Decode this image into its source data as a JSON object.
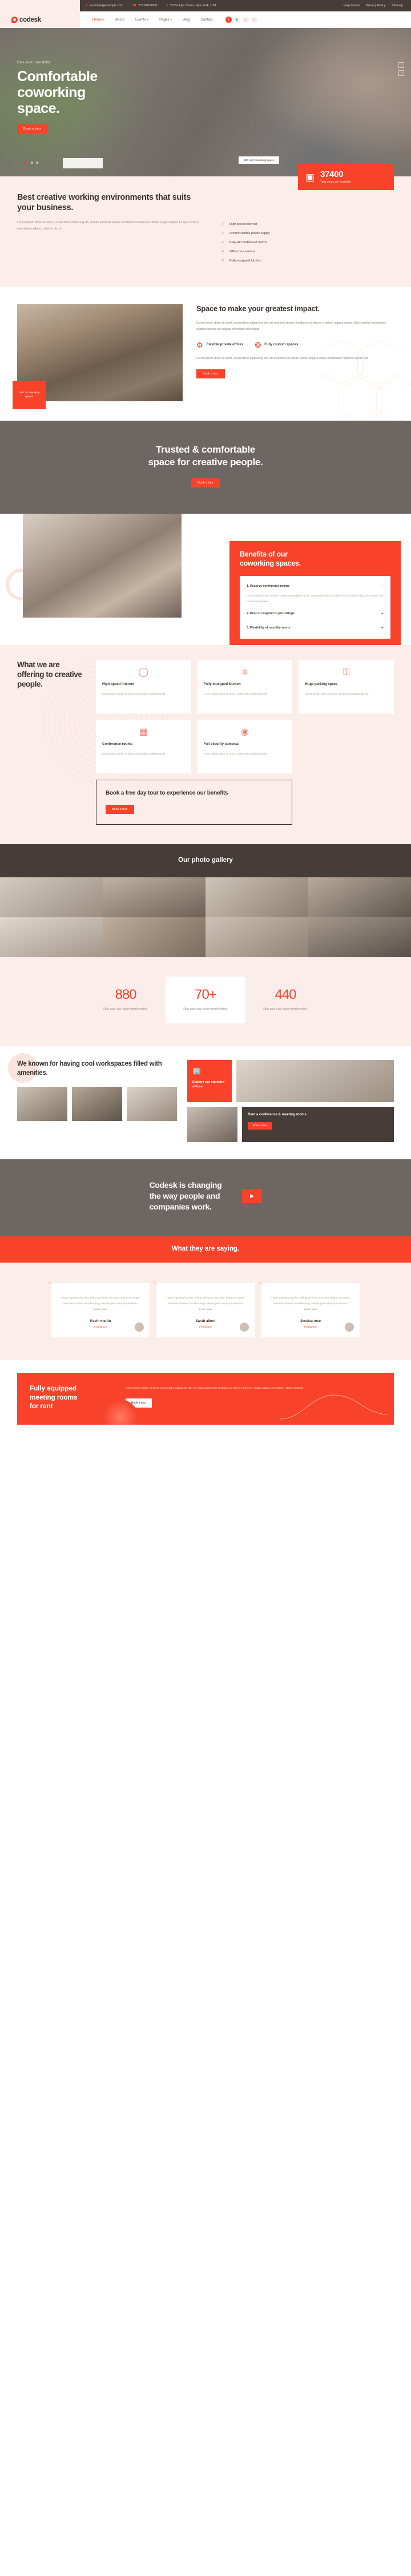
{
  "topbar": {
    "email": "example@example.com",
    "email_icon": "envelope-icon",
    "phone": "777 888 0000",
    "phone_icon": "phone-icon",
    "address": "20 Broklyn Street, New York, USA",
    "address_icon": "location-pin-icon",
    "links": [
      "Help Center",
      "Privacy Policy",
      "Sitemap"
    ]
  },
  "nav": {
    "brand": "codesk",
    "items": [
      {
        "label": "Home",
        "caret": "▾",
        "active": true
      },
      {
        "label": "About",
        "caret": "",
        "active": false
      },
      {
        "label": "Events",
        "caret": "▾",
        "active": false
      },
      {
        "label": "Pages",
        "caret": "▾",
        "active": false
      },
      {
        "label": "Blog",
        "caret": "",
        "active": false
      },
      {
        "label": "Contact",
        "caret": "",
        "active": false
      }
    ],
    "socials": [
      "facebook-icon",
      "twitter-icon",
      "instagram-icon",
      "dribbble-icon"
    ]
  },
  "hero": {
    "eyebrow": "Duis aute irure dolor",
    "title_line1": "Comfortable",
    "title_line2": "coworking",
    "title_line3": "space.",
    "button": "Book a tour",
    "tag": "480 sq ft coworking space",
    "arrow_up": "‹",
    "arrow_down": "›"
  },
  "about": {
    "heading": "Best creative working environments that suits your business.",
    "paragraph": "Lorem ipsum dolor sit amet, consectetur adipiscing elit, sed do eiusmod tempor incididunt ut labore et dolore magna aliqua. Ut quis nostrud exercitation ullamco laboris nisi ut.",
    "counter_number": "37400",
    "counter_label": "Total seats are available",
    "counter_icon": "coworking-seats-icon",
    "checklist": [
      "High speed internet",
      "Uninterruptible power supply",
      "Fully Airconditioned rooms",
      "Office boy service",
      "Fully equipped kitchen"
    ]
  },
  "impact": {
    "badge": "Over 20 coworking spaces",
    "heading": "Space to make your greatest impact.",
    "paragraph": "Lorem ipsum dolor sit amet, consectetur adipiscing elit, set eiusmod tempor incididunt ut labore et dolore magna aliqua. Quis nostrud exercitation ullamco laboris nisi aliquip commodo consequat.",
    "features": [
      {
        "icon": "private-office-icon",
        "title": "Flexible private offices"
      },
      {
        "icon": "custom-space-icon",
        "title": "Fully custom spaces"
      }
    ],
    "paragraph2": "Lorem ipsum dolor sit amet, consectetur adipiscing elit, set incididunt ut labore dolore magna aliqua exercitation ullamco laboris nisi.",
    "button": "Book a tour"
  },
  "trusted": {
    "line1": "Trusted & comfortable",
    "line2": "space for creative people.",
    "button": "Book a tour"
  },
  "benefits": {
    "heading_line1": "Benefits of our",
    "heading_line2": "coworking spaces.",
    "items": [
      {
        "title": "1. Reserve conference rooms",
        "toggle": "−",
        "open": true,
        "body": "Lorem ipsum dolor sit amet, consectetur adipiscing elit, eiusmod tempor incididunt  labore dolore aliqua, excepteur sint occaecat cupidatat."
      },
      {
        "title": "2. Post or respond to job listings",
        "toggle": "+",
        "open": false,
        "body": ""
      },
      {
        "title": "3. Flexibility of monthly terms",
        "toggle": "+",
        "open": false,
        "body": ""
      }
    ]
  },
  "offering": {
    "title": "What we are offering to creative people.",
    "cards": [
      {
        "icon": "wifi-signal-icon",
        "title": "High speed internet",
        "text": "Lorem ipsum dolor sit amet, consectetur adipiscing elit."
      },
      {
        "icon": "kitchen-tray-icon",
        "title": "Fully equipped kitchen",
        "text": "Lorem ipsum dolor sit amet, consectetur adipiscing elit."
      },
      {
        "icon": "parking-car-icon",
        "title": "Huge parking space",
        "text": "Lorem ipsum dolor sit amet, consectetur adipiscing elit."
      },
      {
        "icon": "conference-table-icon",
        "title": "Conference rooms",
        "text": "Lorem ipsum dolor sit amet, consectetur adipiscing elit."
      },
      {
        "icon": "security-camera-icon",
        "title": "Full security cameras",
        "text": "Lorem ipsum dolor sit amet, consectetur adipiscing elit."
      }
    ],
    "cta_title": "Book a free day tour to experience our benefits",
    "cta_button": "Book a tour"
  },
  "gallery": {
    "title": "Our photo gallery"
  },
  "counters": [
    {
      "number": "880",
      "label": "Duis aute irure dolor reprehenderit."
    },
    {
      "number": "70+",
      "label": "Duis aute irure dolor reprehenderit."
    },
    {
      "number": "440",
      "label": "Duis aute irure dolor reprehenderit."
    }
  ],
  "amenities": {
    "heading": "We known for having cool workspaces filled with amenities.",
    "explore_icon": "office-building-icon",
    "explore_title": "Explore our standard offices",
    "rent_title": "Rent a conference & meeting rooms",
    "rent_button": "Book a tour"
  },
  "video": {
    "line1": "Codesk is changing",
    "line2": "the way people and",
    "line3": "companies work.",
    "play_icon": "play-icon"
  },
  "testimonials": {
    "heading": "What they are saying.",
    "items": [
      {
        "quote": "I was impresed by the moling services, not lorem ipsum is simply free text of used by refreshing. Neque porro este qui dolorem ipsum quia.",
        "name": "Kevin martin",
        "role": "Freelancer"
      },
      {
        "quote": "I was impresed by the moling services, not lorem ipsum is simply free text of used by refreshing. Neque porro este qui dolorem ipsum quia.",
        "name": "Sarah albert",
        "role": "Freelancer"
      },
      {
        "quote": "I was impresed by the moling services, not lorem ipsum is simply free text of used by refreshing. Neque porro este qui dolorem ipsum quia.",
        "name": "Jessica rose",
        "role": "Freelancer"
      }
    ]
  },
  "final_cta": {
    "heading_line1": "Fully equipped",
    "heading_line2": "meeting rooms",
    "heading_line3": "for rent",
    "paragraph": "Lorem ipsum dolor sit amet, consectetur adipiscing elit, set eiusmod tempor incididunt ut labore et dolore magna aliqua exercitation ullamco laboris.",
    "button": "Book a tour"
  },
  "colors": {
    "accent": "#f9422a",
    "dark": "#463c38",
    "gray": "#6e6662",
    "cream": "#fbeeea"
  }
}
